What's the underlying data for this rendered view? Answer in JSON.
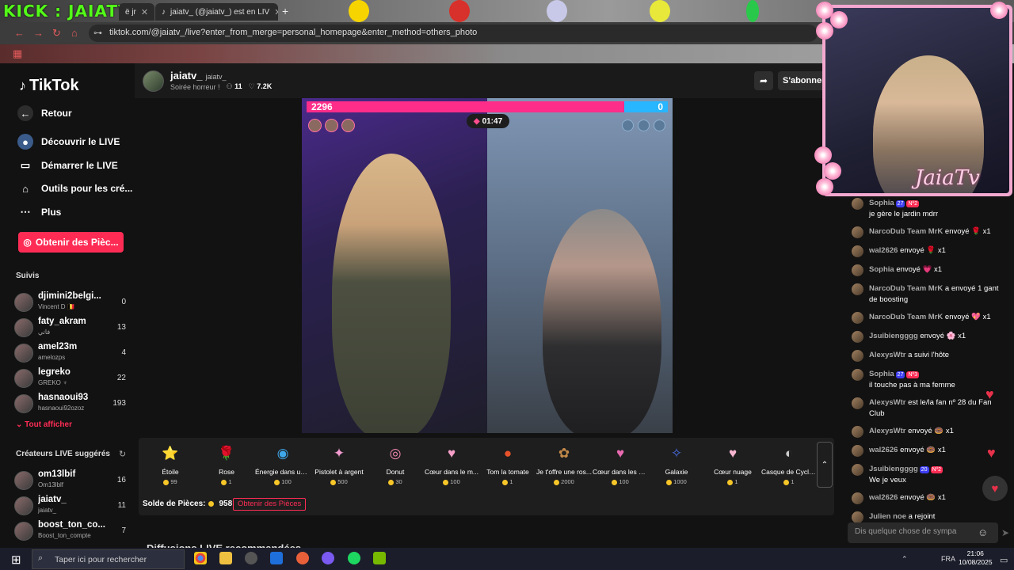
{
  "browser": {
    "overlay_title": "KICK : JAIATV",
    "tab1_label": "ë jr",
    "tab2_label": "jaiatv_ (@jaiatv_) est en LIV",
    "new_tab": "+",
    "url": "tiktok.com/@jaiatv_/live?enter_from_merge=personal_homepage&enter_method=others_photo"
  },
  "sidebar": {
    "logo": "TikTok",
    "nav": [
      {
        "label": "Retour",
        "icon": "arrow-left-icon"
      },
      {
        "label": "Découvrir le LIVE",
        "icon": "live-globe-icon"
      },
      {
        "label": "Démarrer le LIVE",
        "icon": "camera-icon"
      },
      {
        "label": "Outils pour les cré...",
        "icon": "home-tools-icon"
      },
      {
        "label": "Plus",
        "icon": "more-dots-icon"
      }
    ],
    "coins_button": "Obtenir des Pièc...",
    "following_title": "Suivis",
    "following": [
      {
        "name": "djimini2belgi...",
        "sub": "Vincent D 🇧🇪",
        "count": "0"
      },
      {
        "name": "faty_akram",
        "sub": "فاتي",
        "count": "13"
      },
      {
        "name": "amel23m",
        "sub": "amelozps",
        "count": "4"
      },
      {
        "name": "legreko",
        "sub": "GREKO ♆",
        "count": "22"
      },
      {
        "name": "hasnaoui93",
        "sub": "hasnaoui92ozoz",
        "count": "193"
      }
    ],
    "show_all": "Tout afficher",
    "suggested_title": "Créateurs LIVE suggérés",
    "suggested": [
      {
        "name": "om13lbif",
        "sub": "Om13lblf",
        "count": "16"
      },
      {
        "name": "jaiatv_",
        "sub": "jaiatv_",
        "count": "11"
      },
      {
        "name": "boost_ton_co...",
        "sub": "Boost_ton_compte",
        "count": "7"
      }
    ]
  },
  "header": {
    "name": "jaiatv_",
    "handle": "jaiatv_",
    "title": "Soirée horreur !",
    "viewers": "11",
    "likes": "7.2K",
    "subscribe": "S'abonner"
  },
  "battle": {
    "score_left": "2296",
    "score_right": "0",
    "timer": "01:47",
    "progress_left": 0.88
  },
  "gifts": [
    {
      "name": "Étoile",
      "price": "99",
      "icon": "⭐",
      "color": "#f7d046"
    },
    {
      "name": "Rose",
      "price": "1",
      "icon": "🌹",
      "color": "#e8314a"
    },
    {
      "name": "Énergie dans un ...",
      "price": "100",
      "icon": "◉",
      "color": "#3fa6e8"
    },
    {
      "name": "Pistolet à argent",
      "price": "500",
      "icon": "✦",
      "color": "#f29bd0"
    },
    {
      "name": "Donut",
      "price": "30",
      "icon": "◎",
      "color": "#f48bb5"
    },
    {
      "name": "Cœur dans le m...",
      "price": "100",
      "icon": "♥",
      "color": "#f59fc8"
    },
    {
      "name": "Tom la tomate",
      "price": "1",
      "icon": "●",
      "color": "#e8522a"
    },
    {
      "name": "Je t'offre une ros...",
      "price": "2000",
      "icon": "✿",
      "color": "#c58a4a"
    },
    {
      "name": "Cœur dans les m...",
      "price": "100",
      "icon": "♥",
      "color": "#e86ab0"
    },
    {
      "name": "Galaxie",
      "price": "1000",
      "icon": "✧",
      "color": "#4a6ee8"
    },
    {
      "name": "Cœur nuage",
      "price": "1",
      "icon": "♥",
      "color": "#f7b5d0"
    },
    {
      "name": "Casque de Cyclis...",
      "price": "1",
      "icon": "◐",
      "color": "#cccccc"
    }
  ],
  "balance_label": "Solde de Pièces:",
  "balance_value": "958",
  "get_coins": "Obtenir des Pièces",
  "recommended": "Diffusions LIVE recommandées",
  "chat": [
    {
      "user": "Sophia",
      "badges": [
        "27",
        "Nº2"
      ],
      "text": "je gère le jardin mdrr",
      "two_line": true
    },
    {
      "user": "NarcoDub Team MrK",
      "text": "envoyé 🌹 x1"
    },
    {
      "user": "wal2626",
      "text": "envoyé 🌹 x1"
    },
    {
      "user": "Sophia",
      "text": "envoyé 💗 x1"
    },
    {
      "user": "NarcoDub Team MrK",
      "text": "a envoyé 1 gant de boosting"
    },
    {
      "user": "NarcoDub Team MrK",
      "text": "envoyé 💖 x1"
    },
    {
      "user": "Jsuibiengggg",
      "text": "envoyé 🌸 x1"
    },
    {
      "user": "AlexysWtr",
      "text": "a suivi l'hôte"
    },
    {
      "user": "Sophia",
      "badges": [
        "27",
        "Nº3"
      ],
      "text": "il touche pas à ma femme",
      "two_line": true
    },
    {
      "user": "AlexysWtr",
      "text": "est le/la fan nº 28 du Fan Club"
    },
    {
      "user": "AlexysWtr",
      "text": "envoyé 🍩 x1"
    },
    {
      "user": "wal2626",
      "text": "envoyé 🍩 x1"
    },
    {
      "user": "Jsuibiengggg",
      "badges": [
        "20",
        "Nº2"
      ],
      "text": "We je veux",
      "two_line": true
    },
    {
      "user": "wal2626",
      "text": "envoyé 🍩 x1"
    },
    {
      "user": "Julien noe",
      "text": "a rejoint"
    }
  ],
  "chat_placeholder": "Dis quelque chose de sympa",
  "webcam_title": "JaiaTv",
  "taskbar": {
    "search_placeholder": "Taper ici pour rechercher",
    "lang": "FRA",
    "time": "21:06",
    "date": "10/08/2025"
  }
}
